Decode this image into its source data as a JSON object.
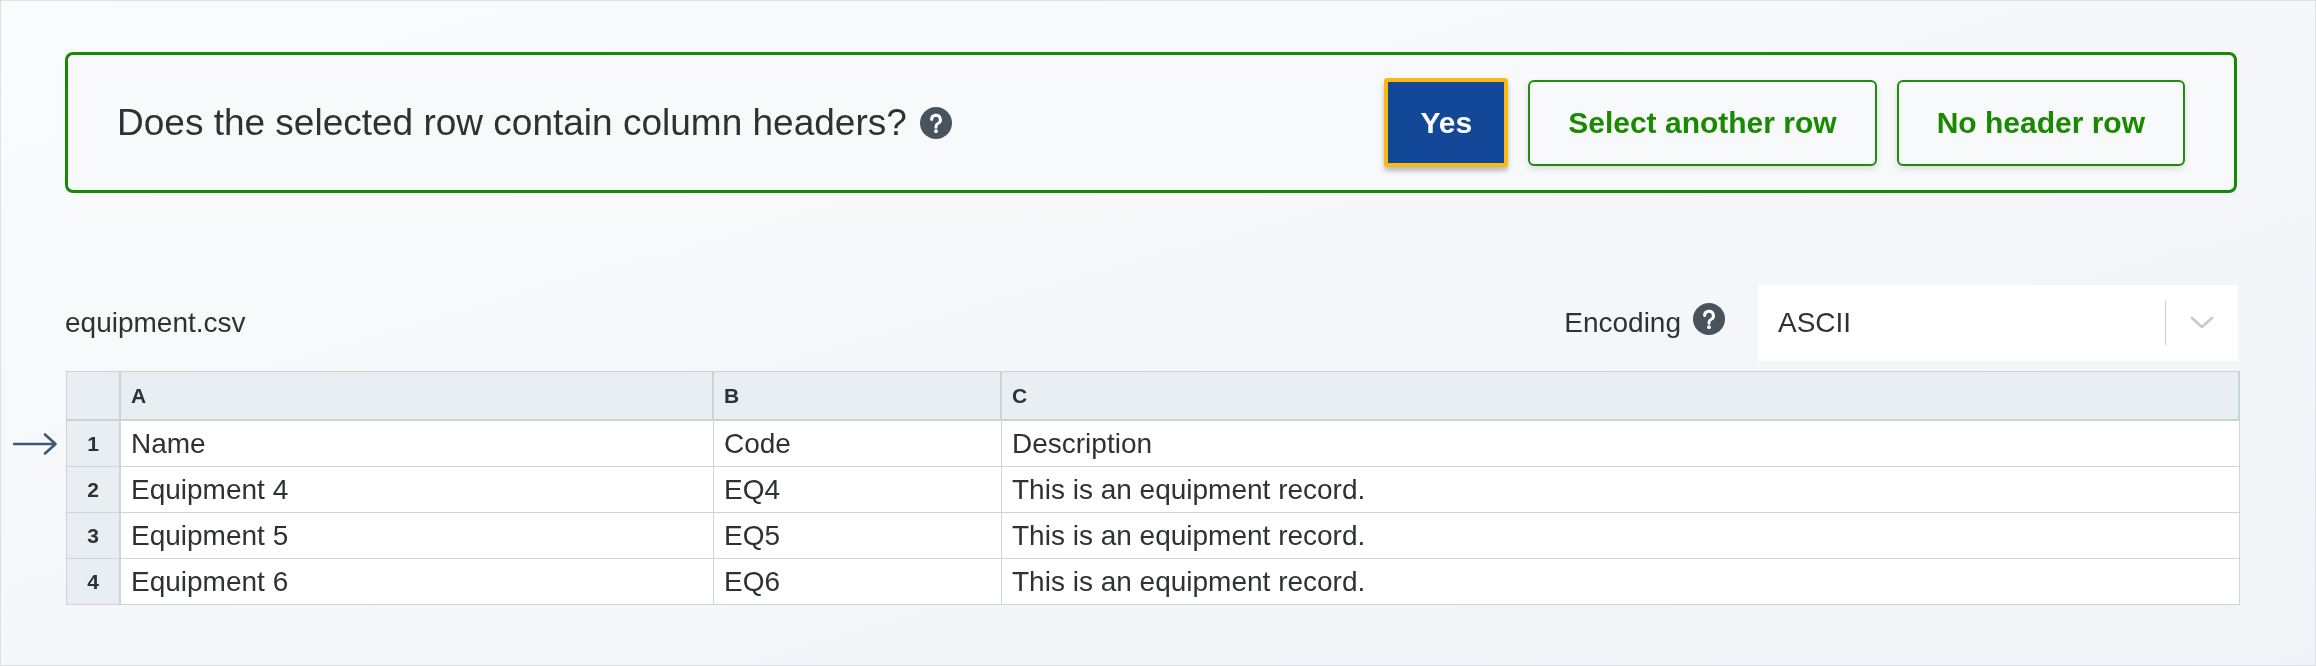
{
  "prompt": {
    "question": "Does the selected row contain column headers?",
    "buttons": [
      {
        "label": "Yes",
        "kind": "primary",
        "focused": true
      },
      {
        "label": "Select another row",
        "kind": "secondary",
        "focused": false
      },
      {
        "label": "No header row",
        "kind": "secondary",
        "focused": false
      }
    ]
  },
  "file": {
    "name": "equipment.csv",
    "encoding": {
      "label": "Encoding",
      "value": "ASCII"
    }
  },
  "table": {
    "columns": [
      "A",
      "B",
      "C"
    ],
    "rows": [
      {
        "number": "1",
        "selected": true,
        "cells": [
          "Name",
          "Code",
          "Description"
        ]
      },
      {
        "number": "2",
        "selected": false,
        "cells": [
          "Equipment 4",
          "EQ4",
          "This is an equipment record."
        ]
      },
      {
        "number": "3",
        "selected": false,
        "cells": [
          "Equipment 5",
          "EQ5",
          "This is an equipment record."
        ]
      },
      {
        "number": "4",
        "selected": false,
        "cells": [
          "Equipment 6",
          "EQ6",
          "This is an equipment record."
        ]
      }
    ]
  }
}
